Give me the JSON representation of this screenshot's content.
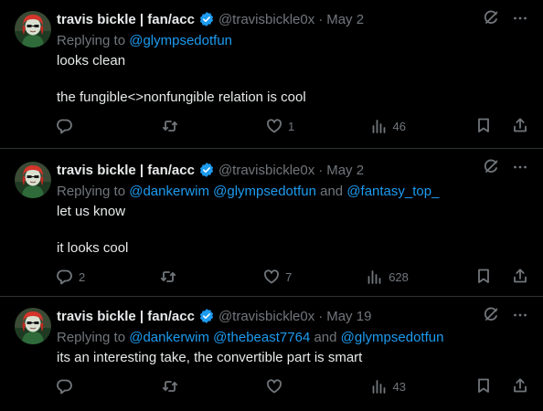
{
  "colors": {
    "background": "#000000",
    "text": "#e7e9ea",
    "muted": "#71767b",
    "accent": "#1d9bf0",
    "divider": "#2f3336"
  },
  "tweets": [
    {
      "author_name": "travis bickle | fan/acc",
      "handle": "@travisbickle0x",
      "separator": "·",
      "date": "May 2",
      "reply_prefix": "Replying to",
      "reply_mentions_1": "@glympsedotfun",
      "reply_and": "",
      "reply_mentions_2": "",
      "text": "looks clean\n\nthe fungible<>nonfungible relation is cool",
      "replies": "",
      "retweets": "",
      "likes": "1",
      "views": "46"
    },
    {
      "author_name": "travis bickle | fan/acc",
      "handle": "@travisbickle0x",
      "separator": "·",
      "date": "May 2",
      "reply_prefix": "Replying to",
      "reply_mentions_1": "@dankerwim @glympsedotfun",
      "reply_and": "and",
      "reply_mentions_2": "@fantasy_top_",
      "text": "let us know\n\nit looks cool",
      "replies": "2",
      "retweets": "",
      "likes": "7",
      "views": "628"
    },
    {
      "author_name": "travis bickle | fan/acc",
      "handle": "@travisbickle0x",
      "separator": "·",
      "date": "May 19",
      "reply_prefix": "Replying to",
      "reply_mentions_1": "@dankerwim @thebeast7764",
      "reply_and": "and",
      "reply_mentions_2": "@glympsedotfun",
      "text": "its an interesting take, the convertible part is smart",
      "replies": "",
      "retweets": "",
      "likes": "",
      "views": "43"
    }
  ],
  "icons": [
    "verified-badge-icon",
    "grok-icon",
    "more-icon",
    "reply-icon",
    "retweet-icon",
    "like-icon",
    "views-icon",
    "bookmark-icon",
    "share-icon"
  ]
}
